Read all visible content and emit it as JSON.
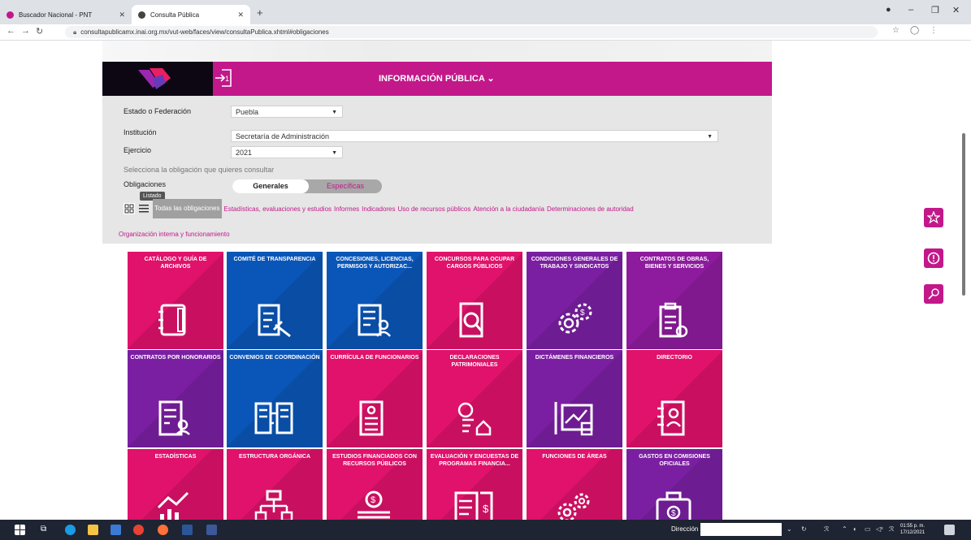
{
  "browser": {
    "tabs": [
      {
        "title": "Buscador Nacional - PNT",
        "fav_color": "#c2188a"
      },
      {
        "title": "Consulta Pública",
        "fav_color": "#444444"
      }
    ],
    "new_tab": "+",
    "url": "consultapublicamx.inai.org.mx/vut-web/faces/view/consultaPublica.xhtml#obligaciones",
    "window_controls": [
      "–",
      "❐",
      "✕"
    ]
  },
  "banner": {
    "title": "INFORMACIÓN PÚBLICA ⌄",
    "color": "#c2188a"
  },
  "form": {
    "estado_label": "Estado o Federación",
    "estado_value": "Puebla",
    "institucion_label": "Institución",
    "institucion_value": "Secretaría de Administración",
    "ejercicio_label": "Ejercicio",
    "ejercicio_value": "2021",
    "hint": "Selecciona la obligación que quieres consultar",
    "obligaciones_label": "Obligaciones",
    "toggle_on": "Generales",
    "toggle_off": "Específicas",
    "tooltip": "Listado"
  },
  "filters": {
    "active": "Todas las obligaciones",
    "items": [
      "Estadísticas, evaluaciones y estudios",
      "Informes",
      "Indicadores",
      "Uso de recursos públicos",
      "Atención a la ciudadanía",
      "Determinaciones de autoridad"
    ],
    "extra": "Organización interna y funcionamiento"
  },
  "tiles": [
    {
      "label": "CATÁLOGO Y GUÍA DE ARCHIVOS",
      "color": "#e0126b",
      "icon": "binder-icon"
    },
    {
      "label": "COMITÉ DE TRANSPARENCIA",
      "color": "#0a56b8",
      "icon": "gavel-document-icon"
    },
    {
      "label": "CONCESIONES, LICENCIAS, PERMISOS Y AUTORIZAC...",
      "color": "#0a56b8",
      "icon": "document-user-icon"
    },
    {
      "label": "CONCURSOS PARA OCUPAR CARGOS PÚBLICOS",
      "color": "#e0126b",
      "icon": "document-search-icon"
    },
    {
      "label": "CONDICIONES GENERALES DE TRABAJO Y SINDICATOS",
      "color": "#7b1fa2",
      "icon": "gears-money-icon"
    },
    {
      "label": "CONTRATOS DE OBRAS, BIENES Y SERVICIOS",
      "color": "#8e1b9e",
      "icon": "clipboard-check-icon"
    },
    {
      "label": "CONTRATOS POR HONORARIOS",
      "color": "#7b1fa2",
      "icon": "document-person-icon"
    },
    {
      "label": "CONVENIOS DE COORDINACIÓN",
      "color": "#0a56b8",
      "icon": "exchange-documents-icon"
    },
    {
      "label": "CURRÍCULA DE FUNCIONARIOS",
      "color": "#e0126b",
      "icon": "resume-icon"
    },
    {
      "label": "DECLARACIONES PATRIMONIALES",
      "color": "#e0126b",
      "icon": "document-house-icon"
    },
    {
      "label": "DICTÁMENES FINANCIEROS",
      "color": "#7b1fa2",
      "icon": "financial-chart-icon"
    },
    {
      "label": "DIRECTORIO",
      "color": "#e0126b",
      "icon": "directory-icon"
    },
    {
      "label": "ESTADÍSTICAS",
      "color": "#e0126b",
      "icon": "stats-chart-icon"
    },
    {
      "label": "ESTRUCTURA ORGÁNICA",
      "color": "#e0126b",
      "icon": "org-chart-icon"
    },
    {
      "label": "ESTUDIOS FINANCIADOS CON RECURSOS PÚBLICOS",
      "color": "#e0126b",
      "icon": "coin-stack-icon"
    },
    {
      "label": "EVALUACIÓN Y ENCUESTAS DE PROGRAMAS FINANCIA...",
      "color": "#e0126b",
      "icon": "survey-money-icon"
    },
    {
      "label": "FUNCIONES DE ÁREAS",
      "color": "#e0126b",
      "icon": "gears-icon"
    },
    {
      "label": "GASTOS EN COMISIONES OFICIALES",
      "color": "#7b1fa2",
      "icon": "briefcase-money-icon"
    }
  ],
  "taskbar": {
    "direccion": "Dirección",
    "time": "01:55 p. m.",
    "date": "17/12/2021"
  }
}
